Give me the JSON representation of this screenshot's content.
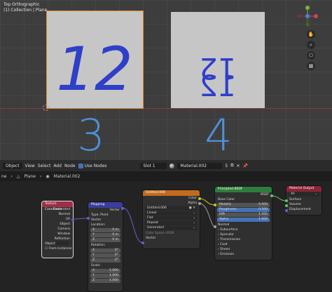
{
  "viewport": {
    "title_line1": "Top Orthographic",
    "title_line2": "(1) Collection | Plane",
    "plane1_text": "12",
    "plane2_text_top": "12",
    "plane2_text_bottom": "12",
    "annotation_left": "3",
    "annotation_right": "4",
    "gizmo_icons": [
      "hand-icon",
      "zoom-icon",
      "camera-icon",
      "grid-icon"
    ]
  },
  "header": {
    "editor_type": "Object",
    "menu": [
      "View",
      "Select",
      "Add",
      "Node"
    ],
    "use_nodes_label": "Use Nodes",
    "slot": "Slot 1",
    "material_name": "Material.002",
    "user_count": "5"
  },
  "breadcrumb": {
    "prefix": "ne",
    "plane": "Plane",
    "material": "Material.002"
  },
  "nodes": {
    "texcoord": {
      "title": "Texture Coordinate",
      "outputs": [
        "Generated",
        "Normal",
        "UV",
        "Object",
        "Camera",
        "Window",
        "Reflection"
      ],
      "object_label": "Object",
      "from_instancer": "From Instancer"
    },
    "mapping": {
      "title": "Mapping",
      "output": "Vector",
      "type_label": "Type:",
      "type_value": "Point",
      "vector_in": "Vector",
      "location_label": "Location:",
      "location": [
        [
          "X",
          "0 m"
        ],
        [
          "Y",
          "0 m"
        ],
        [
          "Z",
          "0 m"
        ]
      ],
      "rotation_label": "Rotation:",
      "rotation": [
        [
          "X",
          "0°"
        ],
        [
          "Y",
          "0°"
        ],
        [
          "Z",
          "0°"
        ]
      ],
      "scale_label": "Scale:",
      "scale": [
        [
          "X",
          "1.000"
        ],
        [
          "Y",
          "1.000"
        ],
        [
          "Z",
          "1.000"
        ]
      ]
    },
    "image": {
      "title": "Untitled.006",
      "outputs": [
        "Color",
        "Alpha"
      ],
      "image_name": "Untitled.006",
      "interpolation": "Linear",
      "projection": "Flat",
      "extension": "Repeat",
      "source": "Generated",
      "color_space_label": "Color Space",
      "color_space": "sRGB",
      "vector_in": "Vector"
    },
    "bsdf": {
      "title": "Principled BSDF",
      "output": "BSDF",
      "base_color": "Base Color",
      "fields": [
        [
          "Metallic",
          "0.000"
        ],
        [
          "Roughness",
          "0.500"
        ],
        [
          "IOR",
          "1.450"
        ],
        [
          "Alpha",
          "1.000"
        ]
      ],
      "normal": "Normal",
      "panels": [
        "Subsurface",
        "Specular",
        "Transmission",
        "Coat",
        "Sheen",
        "Emission"
      ]
    },
    "output": {
      "title": "Material Output",
      "target": "All",
      "inputs": [
        "Surface",
        "Volume",
        "Displacement"
      ]
    }
  },
  "colors": {
    "texcoord_header": "#a12d4a",
    "mapping_header": "#3a3d9e",
    "image_header": "#c26b1e",
    "bsdf_header": "#2f7d3c",
    "output_header": "#8c2435",
    "vector_socket": "#6363c7",
    "color_socket": "#c7c729",
    "float_socket": "#a1a1a1",
    "shader_socket": "#63c763",
    "selection_outline": "#e3862b",
    "annotation": "#4f8fd6"
  }
}
